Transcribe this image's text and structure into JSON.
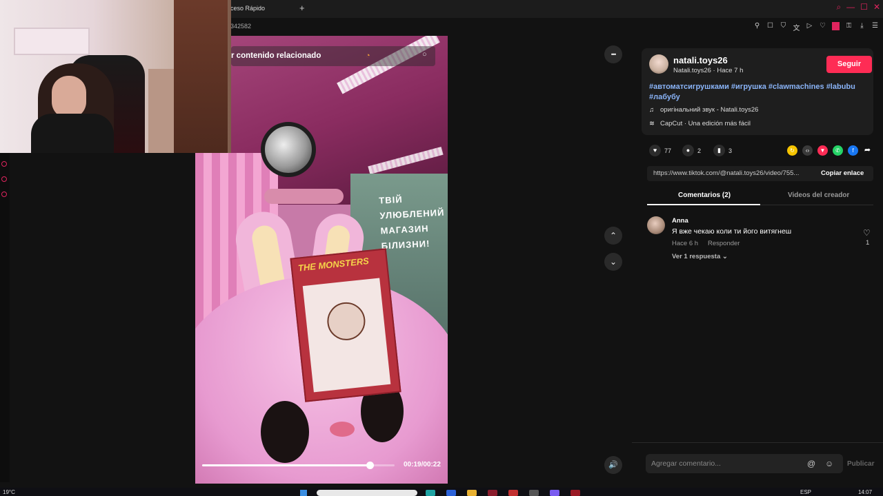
{
  "browser": {
    "tab_label": "ceso Rápido",
    "new_tab": "+",
    "url": "342582",
    "toolbar_icons": [
      "pin-icon",
      "bookmark-icon",
      "shield-icon",
      "translate-icon",
      "send-icon",
      "heart-icon",
      "lock-icon",
      "download-icon",
      "menu-icon"
    ]
  },
  "video": {
    "related_label": "r contenido relacionado",
    "progress": 0.87,
    "time": "00:19/00:22",
    "sign_lines": [
      "ТВІЙ",
      "УЛЮБЛЕНИЙ",
      "МАГАЗИН",
      "БІЛИЗНИ!"
    ],
    "tag_title": "THE MONSTERS"
  },
  "controls": {
    "more": "•••",
    "prev": "⌃",
    "next": "⌄",
    "volume": "🔊"
  },
  "author": {
    "name": "natali.toys26",
    "subtitle": "Natali.toys26 · Hace 7 h",
    "follow": "Seguir",
    "hashtags": "#автоматсигрушками #игрушка #clawmachines #labubu #лабубу",
    "sound": "оригінальний звук - Natali.toys26",
    "capcut": "CapCut · Una edición más fácil"
  },
  "actions": {
    "likes": "77",
    "comments": "2",
    "saves": "3"
  },
  "share": {
    "link": "https://www.tiktok.com/@natali.toys26/video/755...",
    "copy": "Copiar enlace",
    "colors": [
      "#f5c400",
      "#3a3a3a",
      "#fe2c55",
      "#25d366",
      "#1877f2"
    ]
  },
  "tabs": {
    "comments": "Comentarios (2)",
    "creator_videos": "Videos del creador"
  },
  "comment": {
    "author": "Anna",
    "text": "Я вже чекаю коли ти його витягнеш",
    "time": "Hace 6 h",
    "reply": "Responder",
    "more": "Ver 1 respuesta",
    "likes": "1"
  },
  "composer": {
    "placeholder": "Agregar comentario...",
    "publish": "Publicar"
  },
  "taskbar": {
    "weather": "19°C",
    "lang": "ESP",
    "time": "14:07"
  }
}
